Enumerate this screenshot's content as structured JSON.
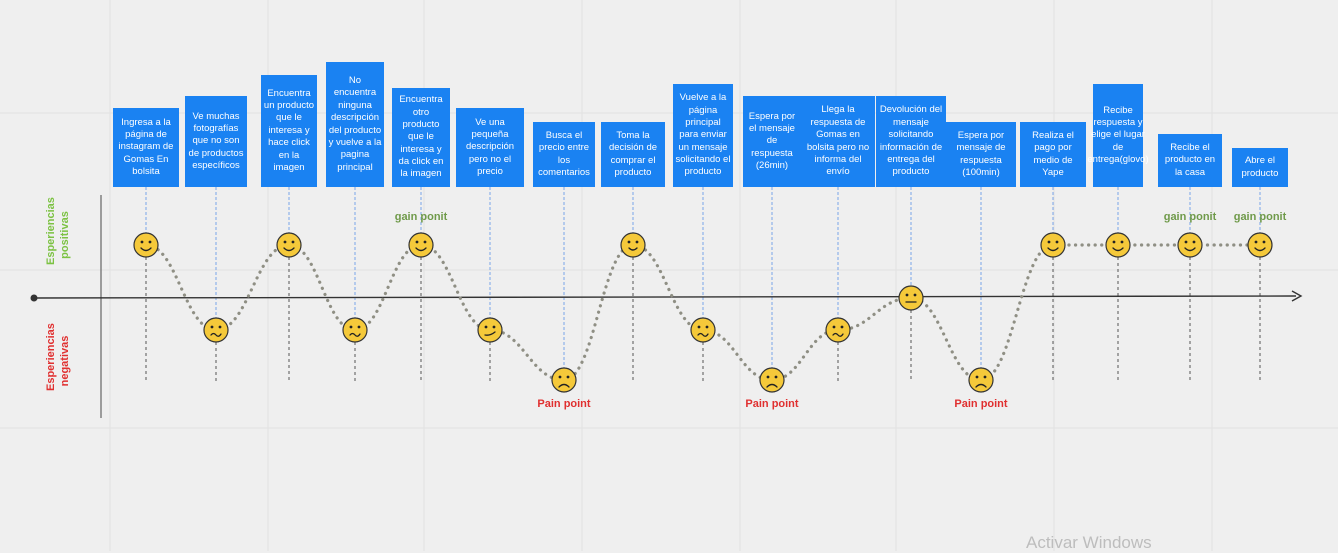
{
  "axis": {
    "positive_label_line1": "Esperiencias",
    "positive_label_line2": "positivas",
    "negative_label_line1": "Esperiencias",
    "negative_label_line2": "negativas"
  },
  "steps": [
    {
      "text": "Ingresa a la página de instagram de Gomas En bolsita",
      "emotion": "happy",
      "level": 1
    },
    {
      "text": "Ve muchas fotografías que no son de productos específicos",
      "emotion": "worried",
      "level": -1
    },
    {
      "text": "Encuentra un producto que le interesa y hace click en la imagen",
      "emotion": "happy",
      "level": 1
    },
    {
      "text": "No encuentra ninguna descripción del producto y vuelve a la pagina principal",
      "emotion": "worried",
      "level": -1
    },
    {
      "text": "Encuentra otro producto que le interesa y da click en la imagen",
      "emotion": "happy",
      "level": 1
    },
    {
      "text": "Ve una pequeña descripción pero no el precio",
      "emotion": "smirk",
      "level": -1
    },
    {
      "text": "Busca el precio entre los comentarios",
      "emotion": "sad",
      "level": -2
    },
    {
      "text": "Toma la decisión de comprar el producto",
      "emotion": "smile",
      "level": 1
    },
    {
      "text": "Vuelve a la página principal para enviar un mensaje solicitando el producto",
      "emotion": "worried",
      "level": -1
    },
    {
      "text": "Espera por el mensaje de respuesta (26min)",
      "emotion": "sad",
      "level": -2
    },
    {
      "text": "Llega la respuesta de Gomas en bolsita pero no informa del envío",
      "emotion": "worried",
      "level": -1
    },
    {
      "text": "Devolución del mensaje solicitando información de entrega del producto",
      "emotion": "neutral",
      "level": 0
    },
    {
      "text": "Espera por mensaje de respuesta (100min)",
      "emotion": "sad",
      "level": -2
    },
    {
      "text": "Realiza el pago por medio de Yape",
      "emotion": "happy",
      "level": 1
    },
    {
      "text": "Recibe respuesta y elige el lugar de entrega(glovo)",
      "emotion": "happy",
      "level": 1
    },
    {
      "text": "Recibe el producto en la casa",
      "emotion": "happy",
      "level": 1
    },
    {
      "text": "Abre el producto",
      "emotion": "happy",
      "level": 1
    }
  ],
  "notes": [
    {
      "text": "gain ponit",
      "type": "gain",
      "step": 4
    },
    {
      "text": "Pain point",
      "type": "pain",
      "step": 6
    },
    {
      "text": "Pain point",
      "type": "pain",
      "step": 9
    },
    {
      "text": "Pain point",
      "type": "pain",
      "step": 12
    },
    {
      "text": "gain ponit",
      "type": "gain",
      "step": 15
    },
    {
      "text": "gain ponit",
      "type": "gain",
      "step": 16
    }
  ],
  "colors": {
    "box": "#1a82f2",
    "connector": "#7aa4e8",
    "curve": "#8f8f84",
    "face": "#f5c93a",
    "axis": "#333333",
    "positive": "#7cc243",
    "negative": "#e03030",
    "gain": "#6f9a4a"
  },
  "watermark": "Activar Windows"
}
